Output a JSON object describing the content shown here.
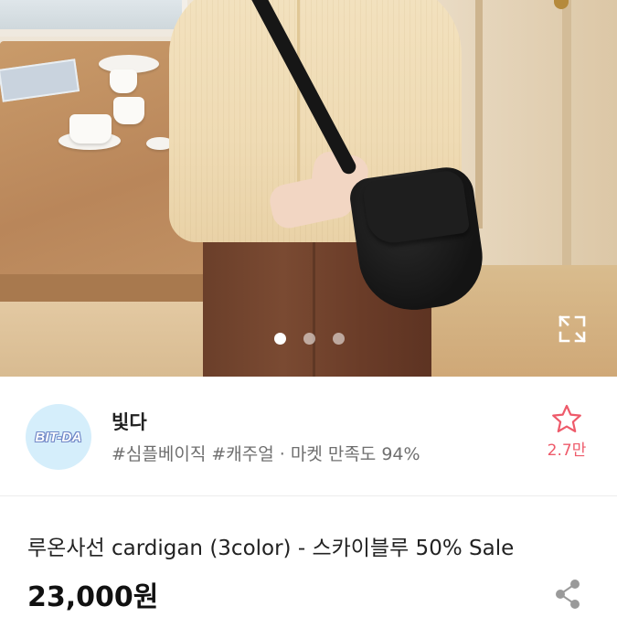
{
  "gallery": {
    "image_count": 3,
    "active_index": 0,
    "expand_icon": "expand-icon"
  },
  "seller": {
    "logo_text": "BIT-DA",
    "name": "빛다",
    "tags": "#심플베이직 #캐주얼 · 마켓 만족도 94%",
    "favorite_count": "2.7만",
    "favorite_icon": "star-outline-icon",
    "accent_color": "#ee5a6a"
  },
  "product": {
    "title": "루온사선 cardigan (3color) - 스카이블루 50%  Sale",
    "price": "23,000원",
    "share_icon": "share-icon"
  }
}
